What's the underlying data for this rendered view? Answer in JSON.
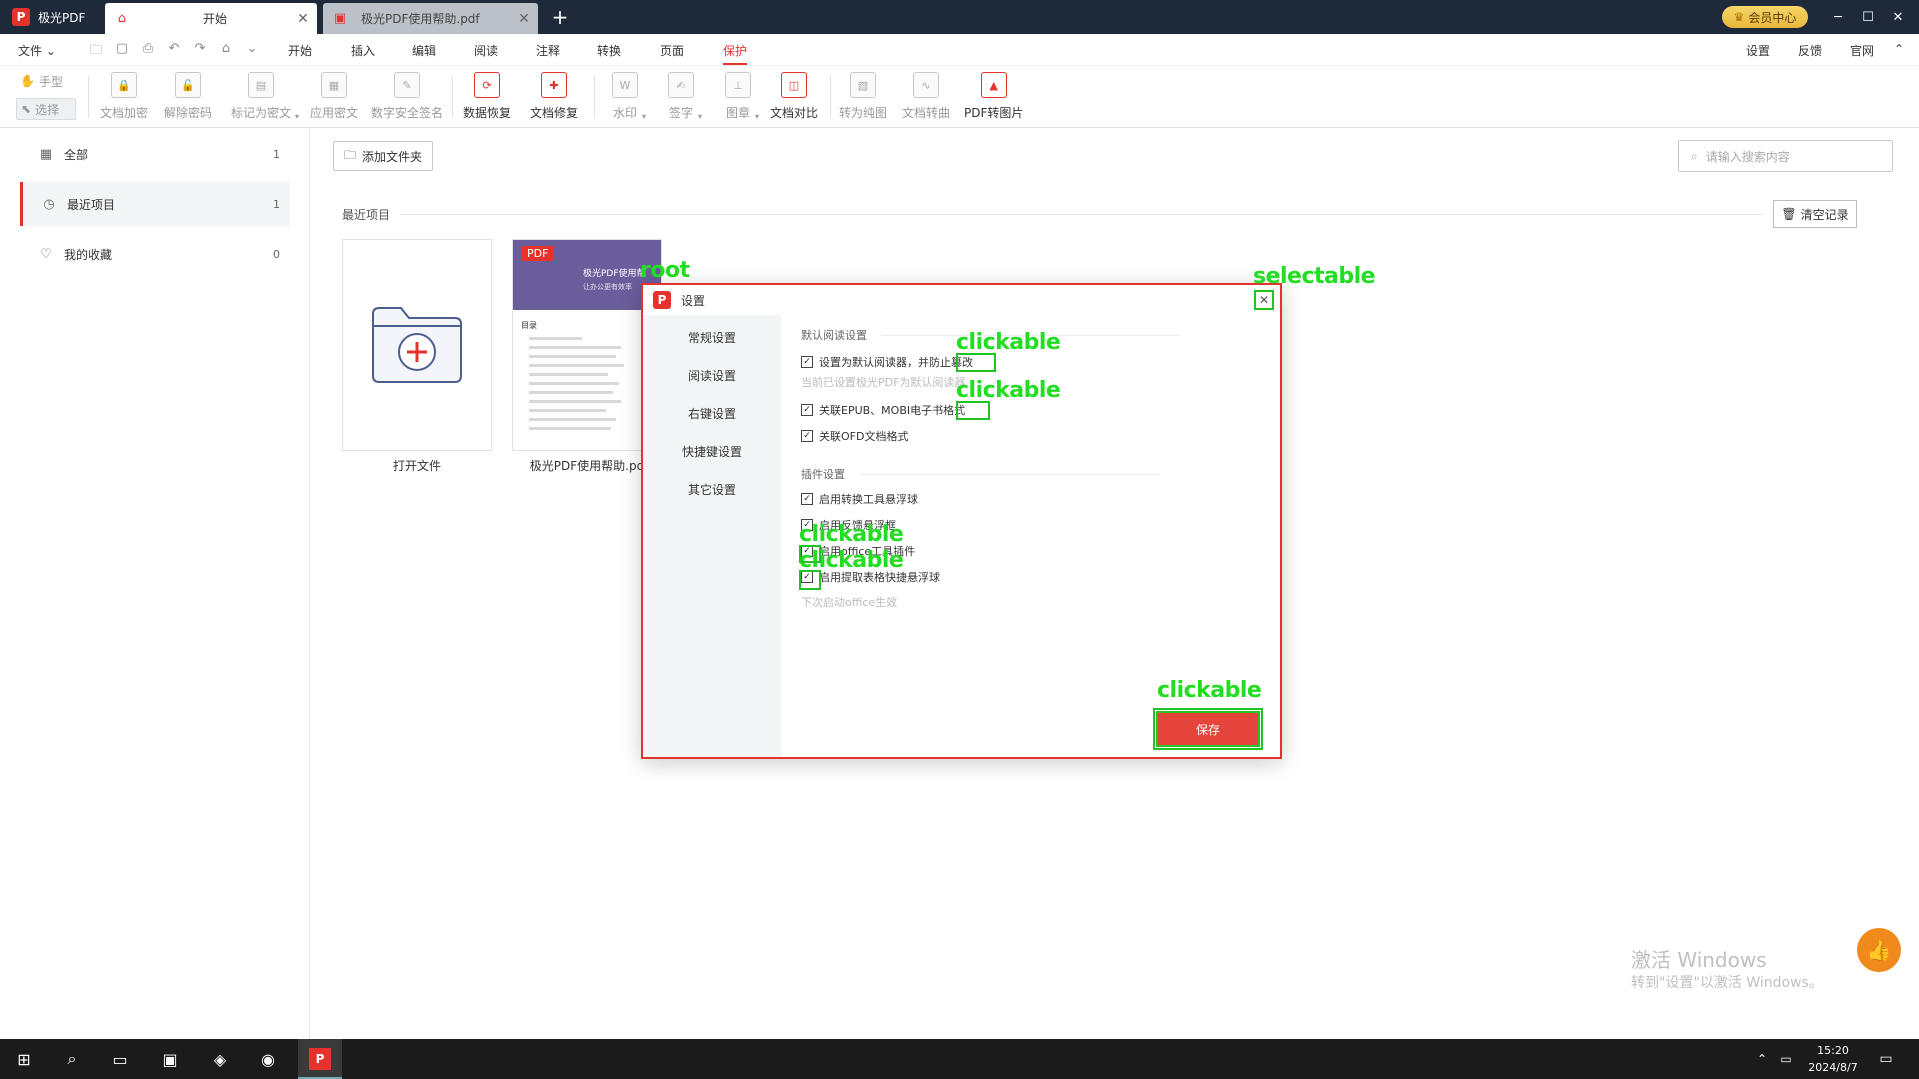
{
  "app": {
    "name": "极光PDF"
  },
  "tabs": [
    {
      "label": "开始"
    },
    {
      "label": "极光PDF使用帮助.pdf"
    }
  ],
  "vip": {
    "label": "会员中心"
  },
  "menu": {
    "file": "文件",
    "items": [
      "开始",
      "插入",
      "编辑",
      "阅读",
      "注释",
      "转换",
      "页面",
      "保护"
    ],
    "active": "保护",
    "right": [
      "设置",
      "反馈",
      "官网"
    ]
  },
  "toolbar": {
    "mode_hand": "手型",
    "mode_select": "选择",
    "tools": [
      "文档加密",
      "解除密码",
      "标记为密文",
      "应用密文",
      "数字安全签名",
      "数据恢复",
      "文档修复",
      "水印",
      "签字",
      "图章",
      "文档对比",
      "转为纯图",
      "文档转曲",
      "PDF转图片"
    ]
  },
  "sidebar": {
    "items": [
      {
        "label": "全部",
        "count": "1"
      },
      {
        "label": "最近项目",
        "count": "1"
      },
      {
        "label": "我的收藏",
        "count": "0"
      }
    ]
  },
  "main": {
    "add_folder": "添加文件夹",
    "search_placeholder": "请输入搜索内容",
    "recent_label": "最近项目",
    "clear": "清空记录",
    "cards": [
      {
        "label": "打开文件"
      },
      {
        "label": "极光PDF使用帮助.pd"
      }
    ],
    "pdf_thumb": {
      "tag": "PDF",
      "title": "极光PDF使用帮",
      "sub": "让办公更有效率",
      "toc": "目录"
    }
  },
  "dialog": {
    "title": "设置",
    "nav": [
      "常规设置",
      "阅读设置",
      "右键设置",
      "快捷键设置",
      "其它设置"
    ],
    "section1": "默认阅读设置",
    "opt_default_reader": "设置为默认阅读器，并防止篡改",
    "hint_default": "当前已设置极光PDF为默认阅读器",
    "opt_epub": "关联EPUB、MOBI电子书格式",
    "opt_ofd": "关联OFD文档格式",
    "section2": "插件设置",
    "opt_float": "启用转换工具悬浮球",
    "opt_feedback": "启用反馈悬浮框",
    "opt_office": "启用office工具插件",
    "opt_table": "启用提取表格快捷悬浮球",
    "hint_office": "下次启动office生效",
    "save": "保存"
  },
  "annotations": {
    "root": "root",
    "selectable": "selectable",
    "clickable": "clickable"
  },
  "watermark": {
    "line1": "激活 Windows",
    "line2": "转到\"设置\"以激活 Windows。"
  },
  "taskbar": {
    "time": "15:20",
    "date": "2024/8/7"
  },
  "colors": {
    "accent": "#e5322d",
    "annotation": "#22c322"
  }
}
